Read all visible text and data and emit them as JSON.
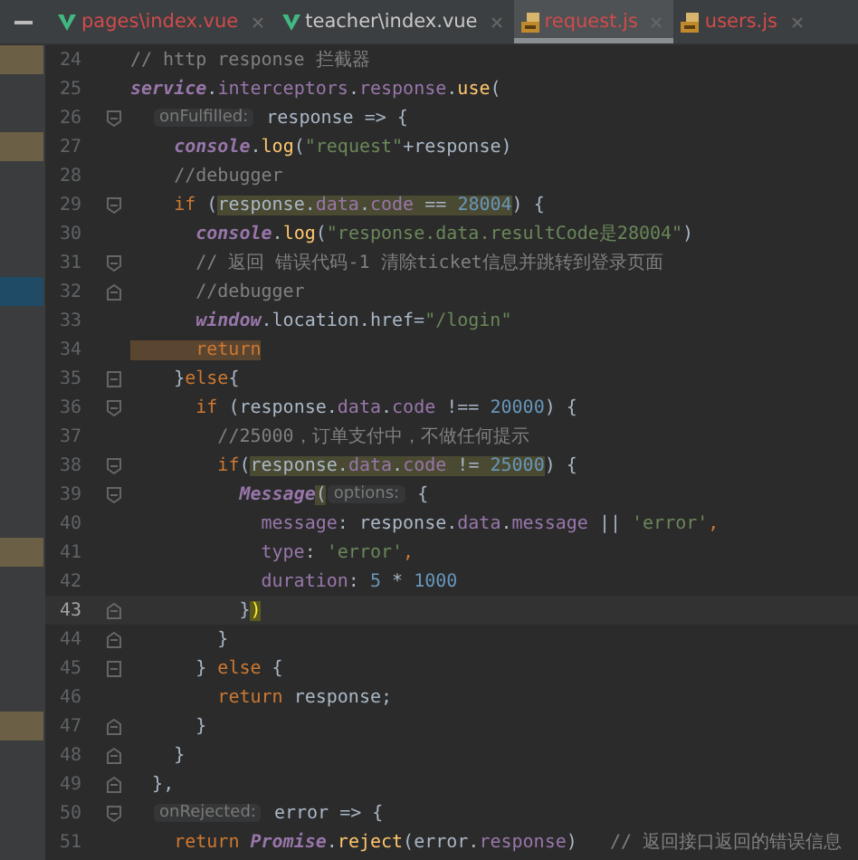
{
  "tabs": [
    {
      "label": "pages\\index.vue",
      "kind": "vue",
      "error": true,
      "selected": false
    },
    {
      "label": "teacher\\index.vue",
      "kind": "vue",
      "error": false,
      "selected": false
    },
    {
      "label": "request.js",
      "kind": "js",
      "error": true,
      "selected": true
    },
    {
      "label": "users.js",
      "kind": "js",
      "error": true,
      "selected": false
    }
  ],
  "lines": [
    {
      "number": "24",
      "current": false,
      "modified": true,
      "marked": false,
      "fold_start": false,
      "fold_end": false,
      "tokens": [
        {
          "kind": "comment",
          "text": "// http response 拦截器"
        }
      ]
    },
    {
      "number": "25",
      "current": false,
      "modified": false,
      "marked": false,
      "fold_start": false,
      "fold_end": false,
      "tokens": [
        {
          "kind": "object",
          "text": "service"
        },
        {
          "kind": "plain",
          "text": "."
        },
        {
          "kind": "prop",
          "text": "interceptors"
        },
        {
          "kind": "plain",
          "text": "."
        },
        {
          "kind": "prop",
          "text": "response"
        },
        {
          "kind": "plain",
          "text": "."
        },
        {
          "kind": "func",
          "text": "use"
        },
        {
          "kind": "plain",
          "text": "("
        }
      ]
    },
    {
      "number": "26",
      "current": false,
      "modified": false,
      "marked": false,
      "fold_start": true,
      "fold_end": false,
      "tokens": [
        {
          "kind": "hint",
          "text": "  onFulfilled:"
        },
        {
          "kind": "plain",
          "text": " response => {"
        }
      ]
    },
    {
      "number": "27",
      "current": false,
      "modified": true,
      "marked": false,
      "fold_start": false,
      "fold_end": false,
      "tokens": [
        {
          "kind": "object",
          "text": "    console"
        },
        {
          "kind": "plain",
          "text": "."
        },
        {
          "kind": "func",
          "text": "log"
        },
        {
          "kind": "plain",
          "text": "("
        },
        {
          "kind": "string",
          "text": "\"request\""
        },
        {
          "kind": "plain",
          "text": "+response)"
        }
      ]
    },
    {
      "number": "28",
      "current": false,
      "modified": false,
      "marked": false,
      "fold_start": false,
      "fold_end": false,
      "tokens": [
        {
          "kind": "comment",
          "text": "    //debugger"
        }
      ]
    },
    {
      "number": "29",
      "current": false,
      "modified": false,
      "marked": false,
      "fold_start": true,
      "fold_end": false,
      "tokens": [
        {
          "kind": "keyword",
          "text": "    if"
        },
        {
          "kind": "plain",
          "text": " ("
        },
        {
          "kind": "match",
          "tokens": [
            {
              "kind": "plain",
              "text": "response."
            },
            {
              "kind": "prop",
              "text": "data"
            },
            {
              "kind": "plain",
              "text": "."
            },
            {
              "kind": "prop",
              "text": "code"
            },
            {
              "kind": "plain",
              "text": " == "
            },
            {
              "kind": "number",
              "text": "28004"
            }
          ]
        },
        {
          "kind": "plain",
          "text": ") {"
        }
      ]
    },
    {
      "number": "30",
      "current": false,
      "modified": false,
      "marked": false,
      "fold_start": false,
      "fold_end": false,
      "tokens": [
        {
          "kind": "object",
          "text": "      console"
        },
        {
          "kind": "plain",
          "text": "."
        },
        {
          "kind": "func",
          "text": "log"
        },
        {
          "kind": "plain",
          "text": "("
        },
        {
          "kind": "string",
          "text": "\"response.data.resultCode是28004\""
        },
        {
          "kind": "plain",
          "text": ")"
        }
      ]
    },
    {
      "number": "31",
      "current": false,
      "modified": false,
      "marked": false,
      "fold_start": true,
      "fold_end": false,
      "tokens": [
        {
          "kind": "comment",
          "text": "      // 返回 错误代码-1 清除ticket信息并跳转到登录页面"
        }
      ]
    },
    {
      "number": "32",
      "current": false,
      "modified": false,
      "marked": true,
      "fold_start": false,
      "fold_end": true,
      "tokens": [
        {
          "kind": "comment",
          "text": "      //debugger"
        }
      ]
    },
    {
      "number": "33",
      "current": false,
      "modified": false,
      "marked": false,
      "fold_start": false,
      "fold_end": false,
      "tokens": [
        {
          "kind": "object",
          "text": "      window"
        },
        {
          "kind": "plain",
          "text": ".location.href="
        },
        {
          "kind": "string",
          "text": "\"/login\""
        }
      ]
    },
    {
      "number": "34",
      "current": false,
      "modified": false,
      "marked": false,
      "fold_start": false,
      "fold_end": false,
      "tokens": [
        {
          "kind": "usage",
          "tokens": [
            {
              "kind": "keyword",
              "text": "      return"
            }
          ]
        }
      ]
    },
    {
      "number": "35",
      "current": false,
      "modified": false,
      "marked": false,
      "fold_start": true,
      "fold_end": true,
      "tokens": [
        {
          "kind": "plain",
          "text": "    }"
        },
        {
          "kind": "keyword",
          "text": "else"
        },
        {
          "kind": "plain",
          "text": "{"
        }
      ]
    },
    {
      "number": "36",
      "current": false,
      "modified": false,
      "marked": false,
      "fold_start": true,
      "fold_end": false,
      "tokens": [
        {
          "kind": "keyword",
          "text": "      if"
        },
        {
          "kind": "plain",
          "text": " (response."
        },
        {
          "kind": "prop",
          "text": "data"
        },
        {
          "kind": "plain",
          "text": "."
        },
        {
          "kind": "prop",
          "text": "code"
        },
        {
          "kind": "plain",
          "text": " !== "
        },
        {
          "kind": "number",
          "text": "20000"
        },
        {
          "kind": "plain",
          "text": ") {"
        }
      ]
    },
    {
      "number": "37",
      "current": false,
      "modified": false,
      "marked": false,
      "fold_start": false,
      "fold_end": false,
      "tokens": [
        {
          "kind": "comment",
          "text": "        //25000，订单支付中，不做任何提示"
        }
      ]
    },
    {
      "number": "38",
      "current": false,
      "modified": false,
      "marked": false,
      "fold_start": true,
      "fold_end": false,
      "tokens": [
        {
          "kind": "keyword",
          "text": "        if"
        },
        {
          "kind": "plain",
          "text": "("
        },
        {
          "kind": "match",
          "tokens": [
            {
              "kind": "plain",
              "text": "response."
            },
            {
              "kind": "prop",
              "text": "data"
            },
            {
              "kind": "plain",
              "text": "."
            },
            {
              "kind": "prop",
              "text": "code"
            },
            {
              "kind": "plain",
              "text": " != "
            },
            {
              "kind": "number",
              "text": "25000"
            }
          ]
        },
        {
          "kind": "plain",
          "text": ") {"
        }
      ]
    },
    {
      "number": "39",
      "current": false,
      "modified": false,
      "marked": false,
      "fold_start": true,
      "fold_end": false,
      "tokens": [
        {
          "kind": "object",
          "text": "          Message"
        },
        {
          "kind": "brace",
          "tokens": [
            {
              "kind": "plain",
              "text": "("
            }
          ]
        },
        {
          "kind": "hint",
          "text": "options:"
        },
        {
          "kind": "plain",
          "text": " {"
        }
      ]
    },
    {
      "number": "40",
      "current": false,
      "modified": false,
      "marked": false,
      "fold_start": false,
      "fold_end": false,
      "tokens": [
        {
          "kind": "prop",
          "text": "            message"
        },
        {
          "kind": "plain",
          "text": ": response."
        },
        {
          "kind": "prop",
          "text": "data"
        },
        {
          "kind": "plain",
          "text": "."
        },
        {
          "kind": "prop",
          "text": "message"
        },
        {
          "kind": "plain",
          "text": " || "
        },
        {
          "kind": "string",
          "text": "'error'"
        },
        {
          "kind": "keyword",
          "text": ","
        }
      ]
    },
    {
      "number": "41",
      "current": false,
      "modified": true,
      "marked": false,
      "fold_start": false,
      "fold_end": false,
      "tokens": [
        {
          "kind": "prop",
          "text": "            type"
        },
        {
          "kind": "plain",
          "text": ": "
        },
        {
          "kind": "string",
          "text": "'error'"
        },
        {
          "kind": "keyword",
          "text": ","
        }
      ]
    },
    {
      "number": "42",
      "current": false,
      "modified": false,
      "marked": false,
      "fold_start": false,
      "fold_end": false,
      "tokens": [
        {
          "kind": "prop",
          "text": "            duration"
        },
        {
          "kind": "plain",
          "text": ": "
        },
        {
          "kind": "number",
          "text": "5"
        },
        {
          "kind": "plain",
          "text": " * "
        },
        {
          "kind": "number",
          "text": "1000"
        }
      ]
    },
    {
      "number": "43",
      "current": true,
      "modified": false,
      "marked": false,
      "fold_start": false,
      "fold_end": true,
      "tokens": [
        {
          "kind": "plain",
          "text": "          }"
        },
        {
          "kind": "brace",
          "tokens": [
            {
              "kind": "plain",
              "text": ")"
            }
          ]
        }
      ]
    },
    {
      "number": "44",
      "current": false,
      "modified": false,
      "marked": false,
      "fold_start": false,
      "fold_end": true,
      "tokens": [
        {
          "kind": "plain",
          "text": "        }"
        }
      ]
    },
    {
      "number": "45",
      "current": false,
      "modified": false,
      "marked": false,
      "fold_start": true,
      "fold_end": true,
      "tokens": [
        {
          "kind": "plain",
          "text": "      } "
        },
        {
          "kind": "keyword",
          "text": "else"
        },
        {
          "kind": "plain",
          "text": " {"
        }
      ]
    },
    {
      "number": "46",
      "current": false,
      "modified": false,
      "marked": false,
      "fold_start": false,
      "fold_end": false,
      "tokens": [
        {
          "kind": "keyword",
          "text": "        return"
        },
        {
          "kind": "plain",
          "text": " response;"
        }
      ]
    },
    {
      "number": "47",
      "current": false,
      "modified": true,
      "marked": false,
      "fold_start": false,
      "fold_end": true,
      "tokens": [
        {
          "kind": "plain",
          "text": "      }"
        }
      ]
    },
    {
      "number": "48",
      "current": false,
      "modified": false,
      "marked": false,
      "fold_start": false,
      "fold_end": true,
      "tokens": [
        {
          "kind": "plain",
          "text": "    }"
        }
      ]
    },
    {
      "number": "49",
      "current": false,
      "modified": false,
      "marked": false,
      "fold_start": false,
      "fold_end": true,
      "tokens": [
        {
          "kind": "plain",
          "text": "  },"
        }
      ]
    },
    {
      "number": "50",
      "current": false,
      "modified": false,
      "marked": false,
      "fold_start": true,
      "fold_end": false,
      "tokens": [
        {
          "kind": "hint",
          "text": "  onRejected:"
        },
        {
          "kind": "plain",
          "text": " error => {"
        }
      ]
    },
    {
      "number": "51",
      "current": false,
      "modified": false,
      "marked": false,
      "fold_start": false,
      "fold_end": false,
      "tokens": [
        {
          "kind": "keyword",
          "text": "    return"
        },
        {
          "kind": "object",
          "text": " Promise"
        },
        {
          "kind": "plain",
          "text": "."
        },
        {
          "kind": "func",
          "text": "reject"
        },
        {
          "kind": "plain",
          "text": "(error."
        },
        {
          "kind": "prop",
          "text": "response"
        },
        {
          "kind": "plain",
          "text": ")"
        },
        {
          "kind": "comment",
          "text": "   // 返回接口返回的错误信息"
        }
      ]
    }
  ]
}
